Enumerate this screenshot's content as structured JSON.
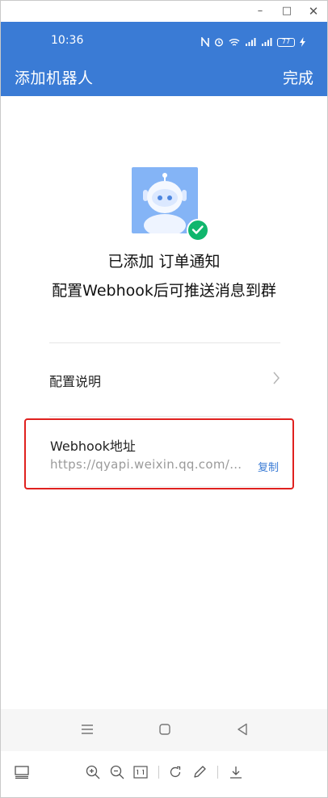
{
  "window": {
    "minimize": "–",
    "maximize": "□",
    "close": "✕"
  },
  "status_bar": {
    "time": "10:36",
    "battery": "77"
  },
  "header": {
    "title": "添加机器人",
    "done_label": "完成"
  },
  "bot": {
    "added_text": "已添加 订单通知",
    "description": "配置Webhook后可推送消息到群"
  },
  "config_row": {
    "label": "配置说明"
  },
  "webhook": {
    "label": "Webhook地址",
    "url": "https://qyapi.weixin.qq.com/c...",
    "copy_label": "复制"
  },
  "colors": {
    "accent": "#3a7bd5",
    "success": "#10b66d",
    "highlight": "#e0211f"
  }
}
